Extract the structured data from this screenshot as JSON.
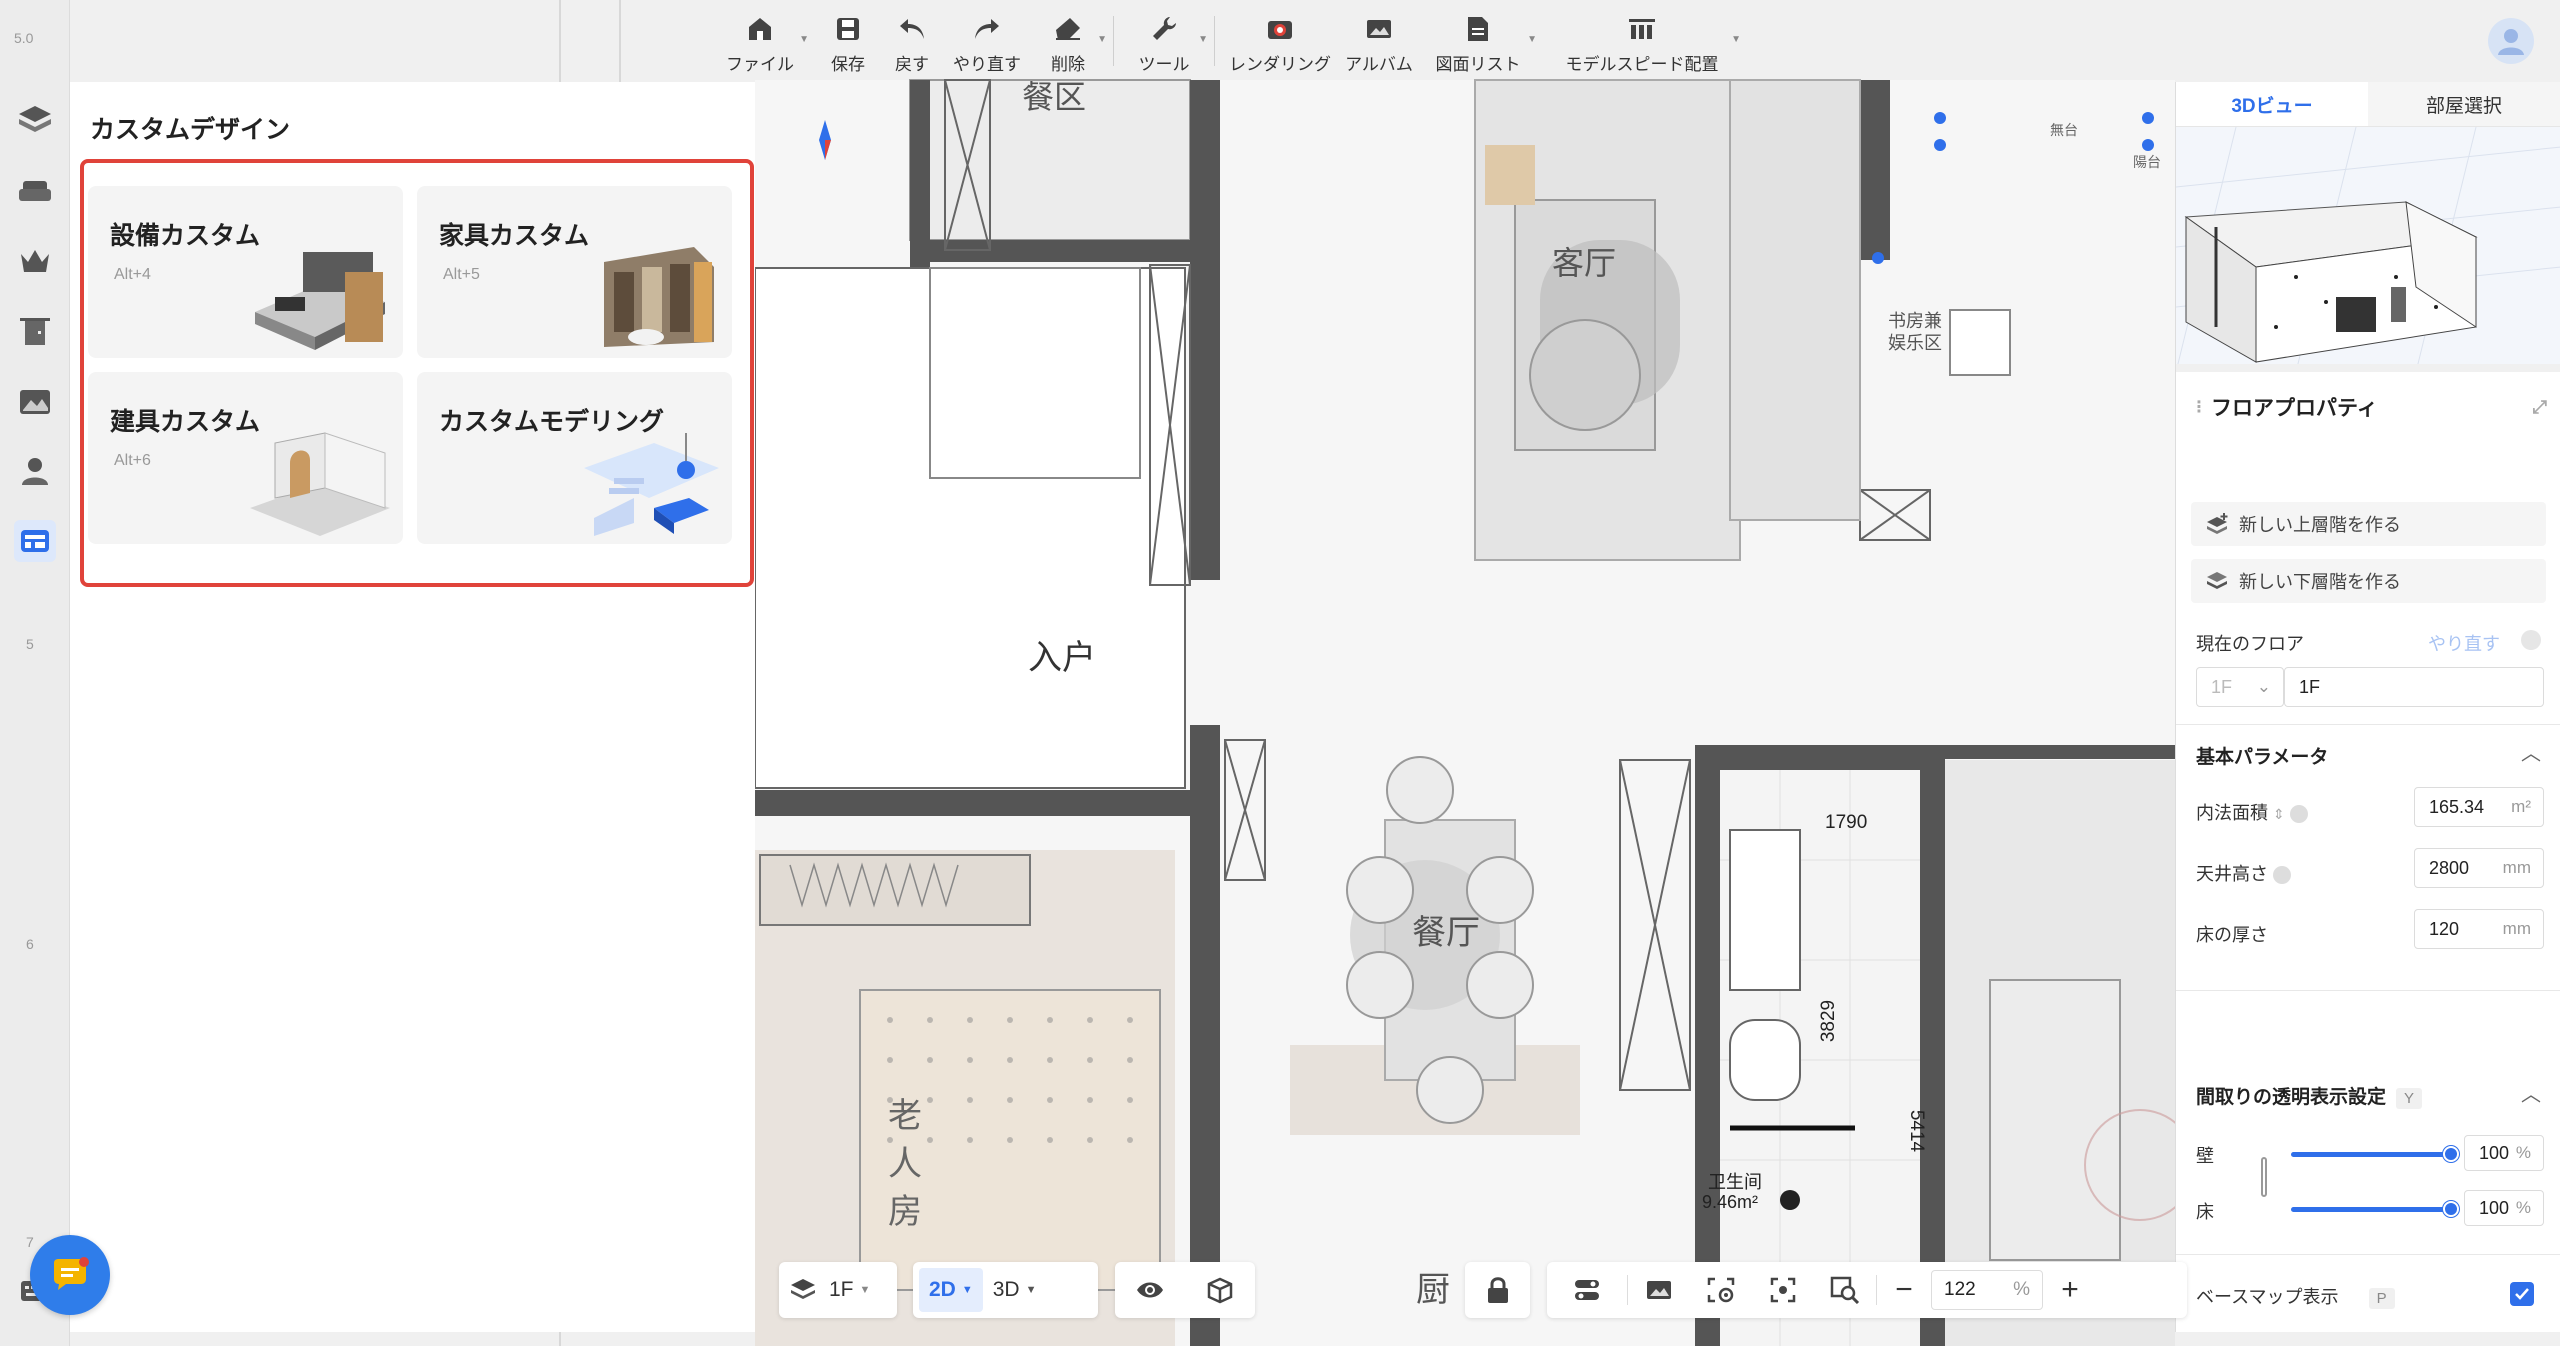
{
  "toolbar": {
    "file": "ファイル",
    "save": "保存",
    "undo": "戻す",
    "redo": "やり直す",
    "delete": "削除",
    "tools": "ツール",
    "rendering": "レンダリング",
    "album": "アルバム",
    "drawing_list": "図面リスト",
    "model_speed": "モデルスピード配置"
  },
  "rail": {
    "ruler_top": "5.0",
    "ruler_marks": [
      "5",
      "6",
      "7"
    ]
  },
  "panel": {
    "title": "カスタムデザイン",
    "cards": [
      {
        "title": "設備カスタム",
        "shortcut": "Alt+4"
      },
      {
        "title": "家具カスタム",
        "shortcut": "Alt+5"
      },
      {
        "title": "建具カスタム",
        "shortcut": "Alt+6"
      },
      {
        "title": "カスタムモデリング",
        "shortcut": ""
      }
    ]
  },
  "canvas": {
    "room_labels": [
      "餐区",
      "客厅",
      "书房兼\n娱乐区",
      "入户",
      "餐厅",
      "老人房",
      "卫生间",
      "厨"
    ],
    "bath_area": "9.46m²",
    "dims": [
      "1790",
      "3829",
      "5414"
    ],
    "tiny_labels": [
      "無台",
      "陽台"
    ]
  },
  "right": {
    "tabs": [
      "3Dビュー",
      "部屋選択"
    ],
    "floor_props_title": "フロアプロパティ",
    "new_upper": "新しい上層階を作る",
    "new_lower": "新しい下層階を作る",
    "current_floor_label": "現在のフロア",
    "redo_link": "やり直す",
    "floor_select": "1F",
    "floor_name": "1F",
    "basic_params": "基本パラメータ",
    "inner_area_label": "内法面積",
    "inner_area_value": "165.34",
    "inner_area_unit": "m²",
    "ceiling_label": "天井高さ",
    "ceiling_value": "2800",
    "ceiling_unit": "mm",
    "floor_thick_label": "床の厚さ",
    "floor_thick_value": "120",
    "floor_thick_unit": "mm",
    "transparency_title": "間取りの透明表示設定",
    "transparency_key": "Y",
    "wall_label": "壁",
    "wall_value": "100",
    "floor_label": "床",
    "floor_value": "100",
    "percent": "%",
    "basemap_label": "ベースマップ表示",
    "basemap_key": "P",
    "basemap_checked": true
  },
  "bottom": {
    "floor": "1F",
    "mode_2d": "2D",
    "mode_3d": "3D",
    "zoom": "122",
    "zoom_unit": "%",
    "canvas_char": "厨"
  },
  "colors": {
    "accent": "#2f6fea",
    "highlight_frame": "#e0433a"
  }
}
